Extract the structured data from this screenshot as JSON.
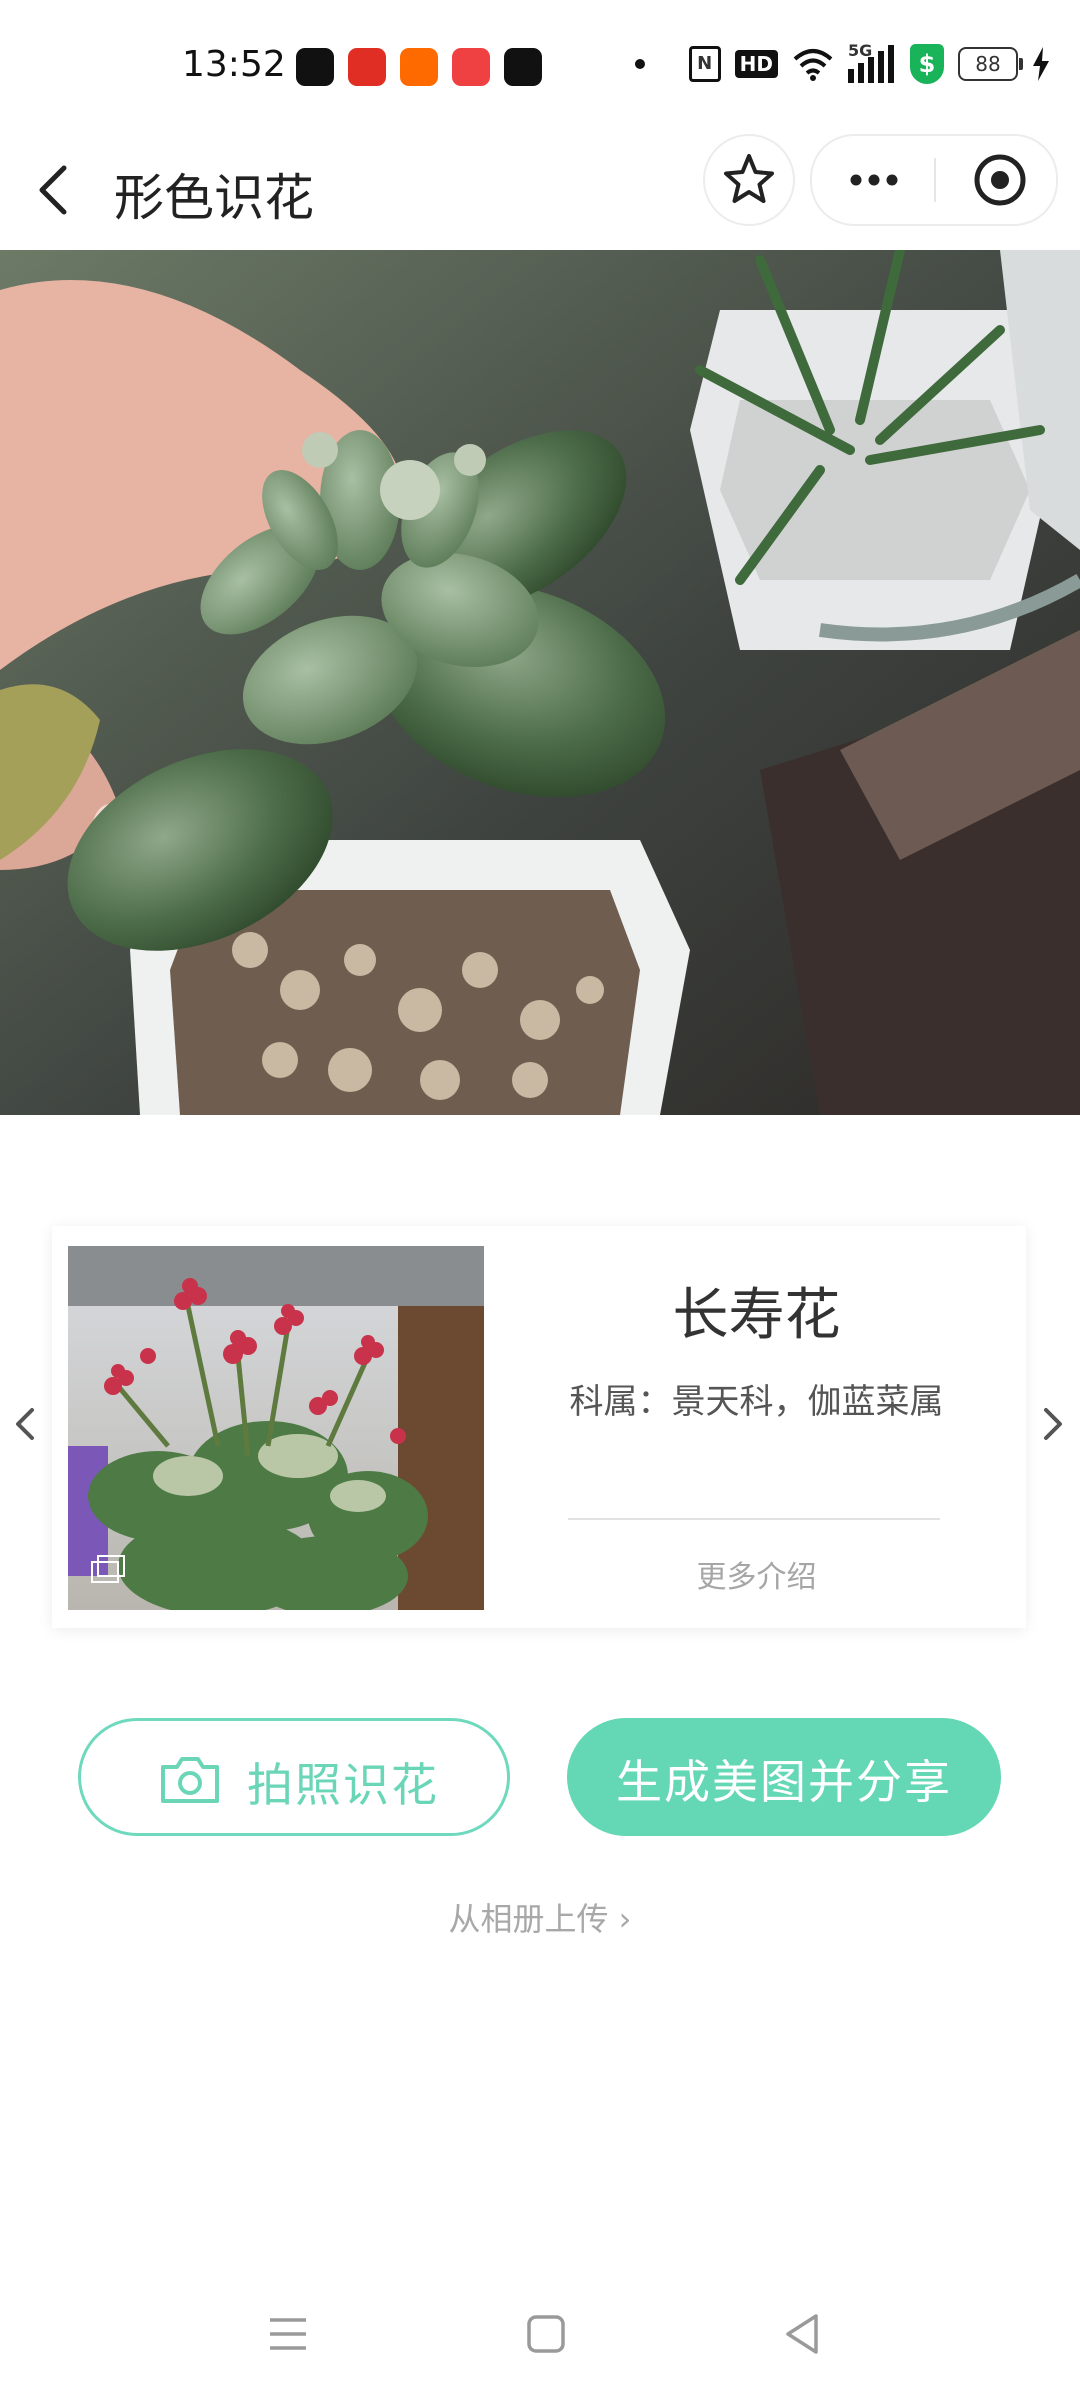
{
  "status_bar": {
    "time": "13:52",
    "app_icons": [
      {
        "name": "tiktok-icon",
        "color": "#111111"
      },
      {
        "name": "pinduoduo-icon",
        "color": "#e02e24"
      },
      {
        "name": "fanqie-icon",
        "color": "#ff6a00"
      },
      {
        "name": "toutiao-icon",
        "color": "#f04142"
      },
      {
        "name": "capcut-icon",
        "color": "#111111"
      }
    ],
    "hd_label": "HD",
    "network_label": "5G",
    "battery": "88",
    "shield_label": "$"
  },
  "title_bar": {
    "title": "形色识花",
    "icons": {
      "back": "chevron-left-icon",
      "favorite": "star-icon",
      "more": "more-dots-icon",
      "close": "target-circle-icon"
    }
  },
  "result": {
    "name": "长寿花",
    "family": "科属：景天科，伽蓝菜属",
    "more": "更多介绍",
    "colors": {
      "card_bg": "#ffffff"
    }
  },
  "actions": {
    "photo_button": "拍照识花",
    "share_button": "生成美图并分享",
    "upload_link": "从相册上传 ›",
    "accent": "#64d7b4"
  },
  "nav_bar": {
    "icons": [
      "menu-icon",
      "home-square-icon",
      "back-triangle-icon"
    ]
  }
}
